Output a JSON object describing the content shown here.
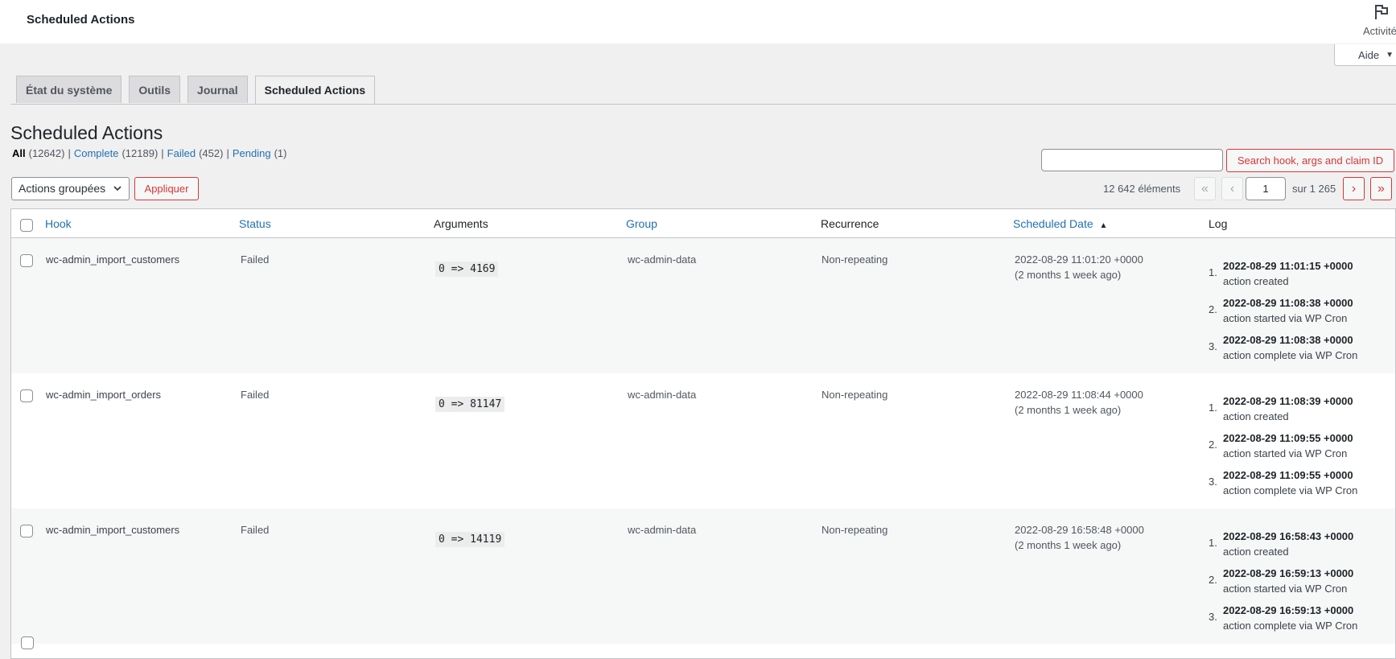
{
  "header": {
    "title": "Scheduled Actions",
    "activity_label": "Activité"
  },
  "help": {
    "label": "Aide"
  },
  "tabs": [
    {
      "label": "État du système"
    },
    {
      "label": "Outils"
    },
    {
      "label": "Journal"
    },
    {
      "label": "Scheduled Actions"
    }
  ],
  "page_title": "Scheduled Actions",
  "filters": {
    "all": "All",
    "all_count": "(12642)",
    "complete": "Complete",
    "complete_count": "(12189)",
    "failed": "Failed",
    "failed_count": "(452)",
    "pending": "Pending",
    "pending_count": "(1)",
    "sep": "|"
  },
  "search": {
    "button": "Search hook, args and claim ID",
    "value": ""
  },
  "bulk": {
    "selected": "Actions groupées",
    "apply": "Appliquer"
  },
  "pagination": {
    "displaying": "12 642 éléments",
    "first": "«",
    "prev": "‹",
    "next": "›",
    "last": "»",
    "current": "1",
    "total": "sur 1 265"
  },
  "columns": {
    "hook": "Hook",
    "status": "Status",
    "arguments": "Arguments",
    "group": "Group",
    "recurrence": "Recurrence",
    "scheduled_date": "Scheduled Date",
    "sort_arrow": "▲",
    "log": "Log"
  },
  "rows": [
    {
      "hook": "wc-admin_import_customers",
      "status": "Failed",
      "args": "0 => 4169",
      "group": "wc-admin-data",
      "recurrence": "Non-repeating",
      "date": "2022-08-29 11:01:20 +0000",
      "relative": "(2 months 1 week ago)",
      "log": [
        {
          "n": "1.",
          "date": "2022-08-29 11:01:15 +0000",
          "msg": "action created"
        },
        {
          "n": "2.",
          "date": "2022-08-29 11:08:38 +0000",
          "msg": "action started via WP Cron"
        },
        {
          "n": "3.",
          "date": "2022-08-29 11:08:38 +0000",
          "msg": "action complete via WP Cron"
        }
      ]
    },
    {
      "hook": "wc-admin_import_orders",
      "status": "Failed",
      "args": "0 => 81147",
      "group": "wc-admin-data",
      "recurrence": "Non-repeating",
      "date": "2022-08-29 11:08:44 +0000",
      "relative": "(2 months 1 week ago)",
      "log": [
        {
          "n": "1.",
          "date": "2022-08-29 11:08:39 +0000",
          "msg": "action created"
        },
        {
          "n": "2.",
          "date": "2022-08-29 11:09:55 +0000",
          "msg": "action started via WP Cron"
        },
        {
          "n": "3.",
          "date": "2022-08-29 11:09:55 +0000",
          "msg": "action complete via WP Cron"
        }
      ]
    },
    {
      "hook": "wc-admin_import_customers",
      "status": "Failed",
      "args": "0 => 14119",
      "group": "wc-admin-data",
      "recurrence": "Non-repeating",
      "date": "2022-08-29 16:58:48 +0000",
      "relative": "(2 months 1 week ago)",
      "log": [
        {
          "n": "1.",
          "date": "2022-08-29 16:58:43 +0000",
          "msg": "action created"
        },
        {
          "n": "2.",
          "date": "2022-08-29 16:59:13 +0000",
          "msg": "action started via WP Cron"
        },
        {
          "n": "3.",
          "date": "2022-08-29 16:59:13 +0000",
          "msg": "action complete via WP Cron"
        }
      ]
    }
  ]
}
